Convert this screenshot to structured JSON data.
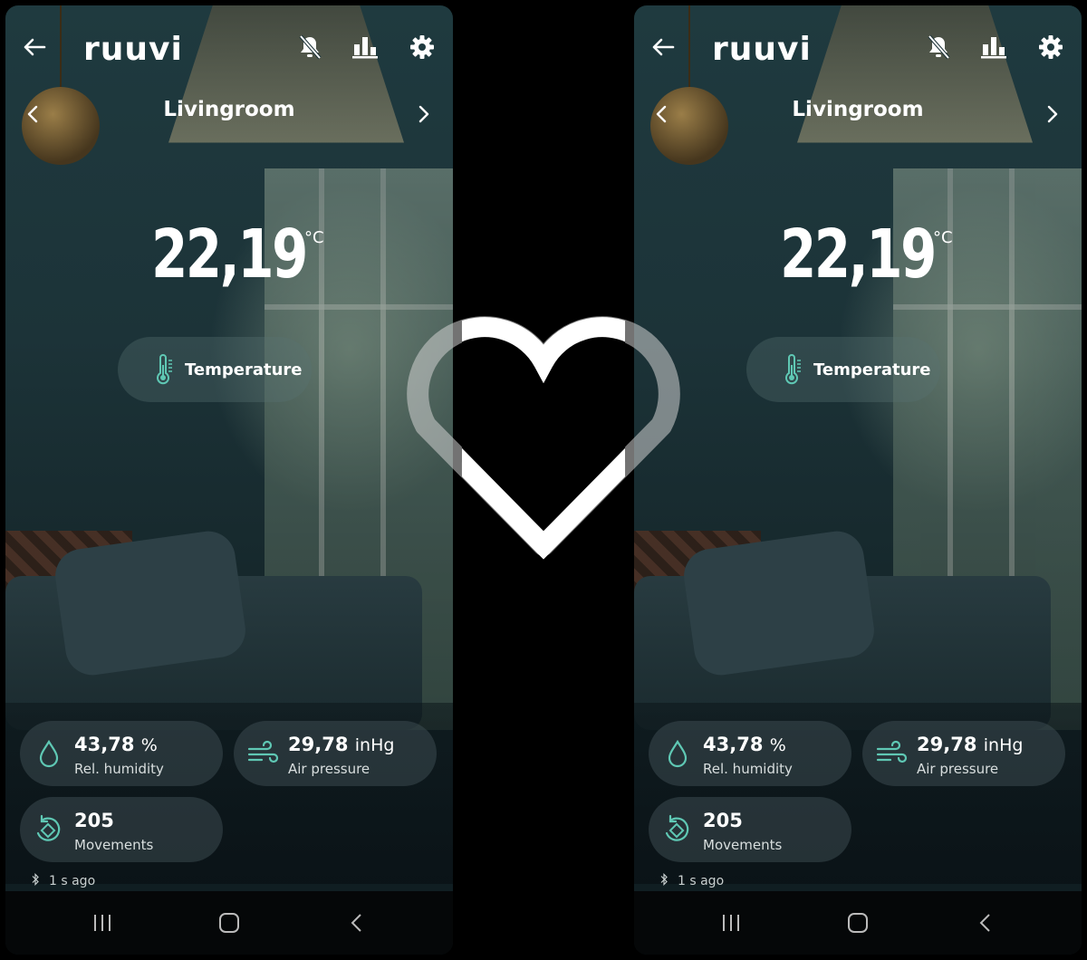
{
  "app": {
    "logo": "ruuvi"
  },
  "sensor": {
    "name": "Livingroom"
  },
  "reading": {
    "temperature": "22,19",
    "temperature_unit": "°C",
    "mode_label": "Temperature"
  },
  "metrics": {
    "humidity": {
      "value": "43,78",
      "unit": "%",
      "label": "Rel. humidity"
    },
    "pressure": {
      "value": "29,78",
      "unit": "inHg",
      "label": "Air pressure"
    },
    "movements": {
      "value": "205",
      "label": "Movements"
    }
  },
  "status": {
    "updated": "1 s ago"
  },
  "colors": {
    "accent": "#5fc8b4",
    "background": "#000000",
    "card": "#3c4b50"
  },
  "icons": {
    "back": "back-arrow-icon",
    "alerts": "bell-off-icon",
    "history": "bar-chart-icon",
    "settings": "gear-icon",
    "prev": "chevron-left-icon",
    "next": "chevron-right-icon",
    "thermometer": "thermometer-icon",
    "humidity": "water-drop-icon",
    "pressure": "wind-icon",
    "movement": "rotate-icon",
    "bluetooth": "bluetooth-icon",
    "heart": "heart-icon"
  }
}
